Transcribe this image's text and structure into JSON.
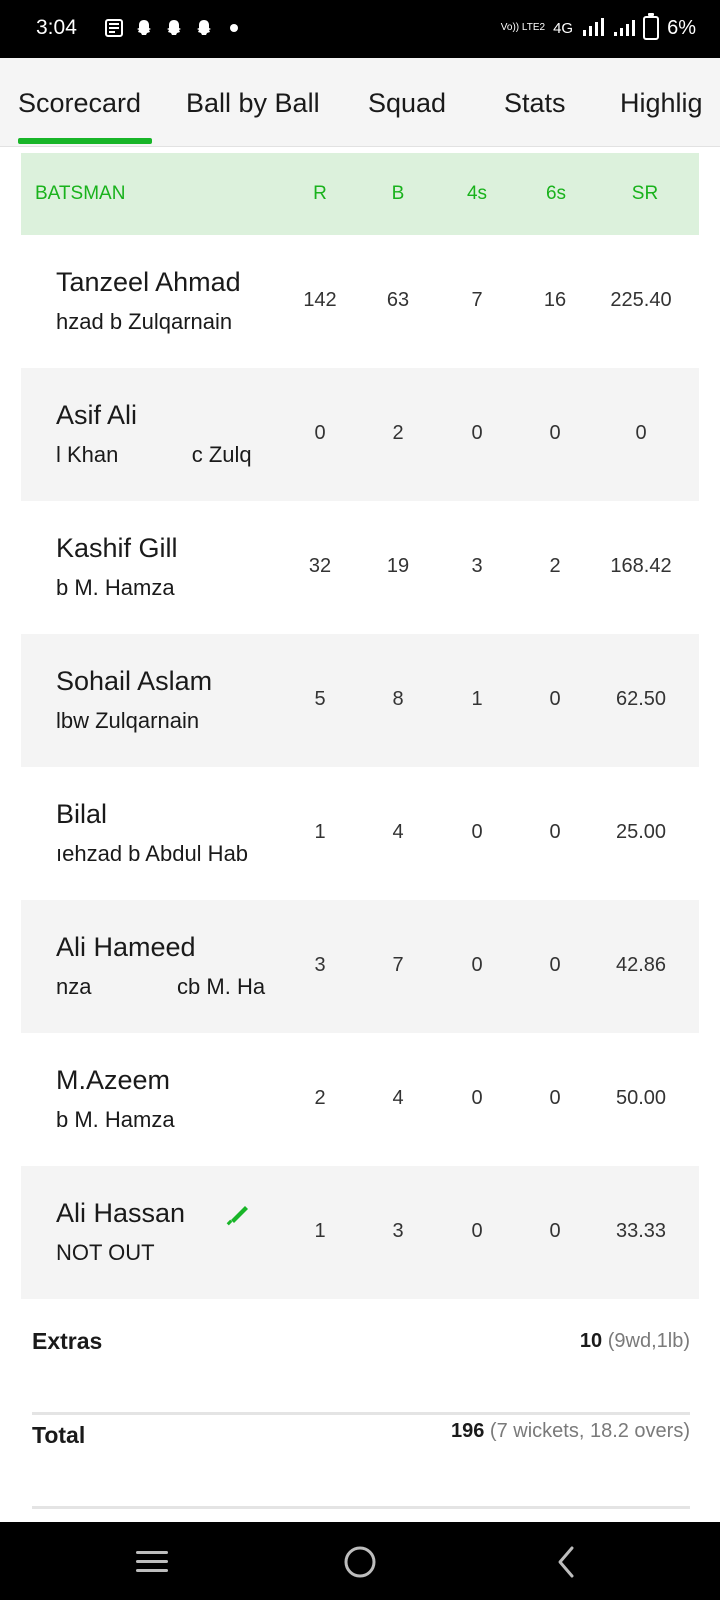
{
  "status_bar": {
    "time": "3:04",
    "volte_label": "Vo)) LTE2",
    "network": "4G",
    "battery": "6%",
    "icons_left": [
      "news-icon",
      "snapchat-icon",
      "snapchat-icon",
      "snapchat-icon",
      "dot-icon"
    ]
  },
  "tabs": [
    {
      "label": "Scorecard",
      "active": true
    },
    {
      "label": "Ball by Ball",
      "active": false
    },
    {
      "label": "Squad",
      "active": false
    },
    {
      "label": "Stats",
      "active": false
    },
    {
      "label": "Highlig",
      "active": false
    }
  ],
  "table": {
    "headers": {
      "batsman": "BATSMAN",
      "r": "R",
      "b": "B",
      "fours": "4s",
      "sixes": "6s",
      "sr": "SR"
    },
    "rows": [
      {
        "name": "Tanzeel Ahmad",
        "dismissal": "hzad b Zulqarnain",
        "r": "142",
        "b": "63",
        "fours": "7",
        "sixes": "16",
        "sr": "225.40"
      },
      {
        "name": "Asif Ali",
        "dismissal": "l Khan            c Zulq",
        "r": "0",
        "b": "2",
        "fours": "0",
        "sixes": "0",
        "sr": "0"
      },
      {
        "name": "Kashif Gill",
        "dismissal": "b M. Hamza",
        "r": "32",
        "b": "19",
        "fours": "3",
        "sixes": "2",
        "sr": "168.42"
      },
      {
        "name": "Sohail Aslam",
        "dismissal": "lbw Zulqarnain",
        "r": "5",
        "b": "8",
        "fours": "1",
        "sixes": "0",
        "sr": "62.50"
      },
      {
        "name": "Bilal",
        "dismissal": "ıehzad b Abdul Hab",
        "r": "1",
        "b": "4",
        "fours": "0",
        "sixes": "0",
        "sr": "25.00"
      },
      {
        "name": "Ali Hameed",
        "dismissal": "nza              cb M. Ha",
        "r": "3",
        "b": "7",
        "fours": "0",
        "sixes": "0",
        "sr": "42.86"
      },
      {
        "name": "M.Azeem",
        "dismissal": "b M. Hamza",
        "r": "2",
        "b": "4",
        "fours": "0",
        "sixes": "0",
        "sr": "50.00"
      },
      {
        "name": "Ali Hassan",
        "dismissal": "NOT OUT",
        "r": "1",
        "b": "3",
        "fours": "0",
        "sixes": "0",
        "sr": "33.33",
        "on_strike_icon": "cricket-bat-icon"
      }
    ]
  },
  "extras": {
    "label": "Extras",
    "value": "10",
    "detail": "(9wd,1lb)"
  },
  "total": {
    "label": "Total",
    "value": "196",
    "detail": "(7 wickets, 18.2 overs)"
  },
  "colors": {
    "accent": "#18b528",
    "header_bg": "#dcf1dc",
    "header_text": "#19b21c"
  },
  "nav": [
    "recents-icon",
    "home-icon",
    "back-icon"
  ]
}
